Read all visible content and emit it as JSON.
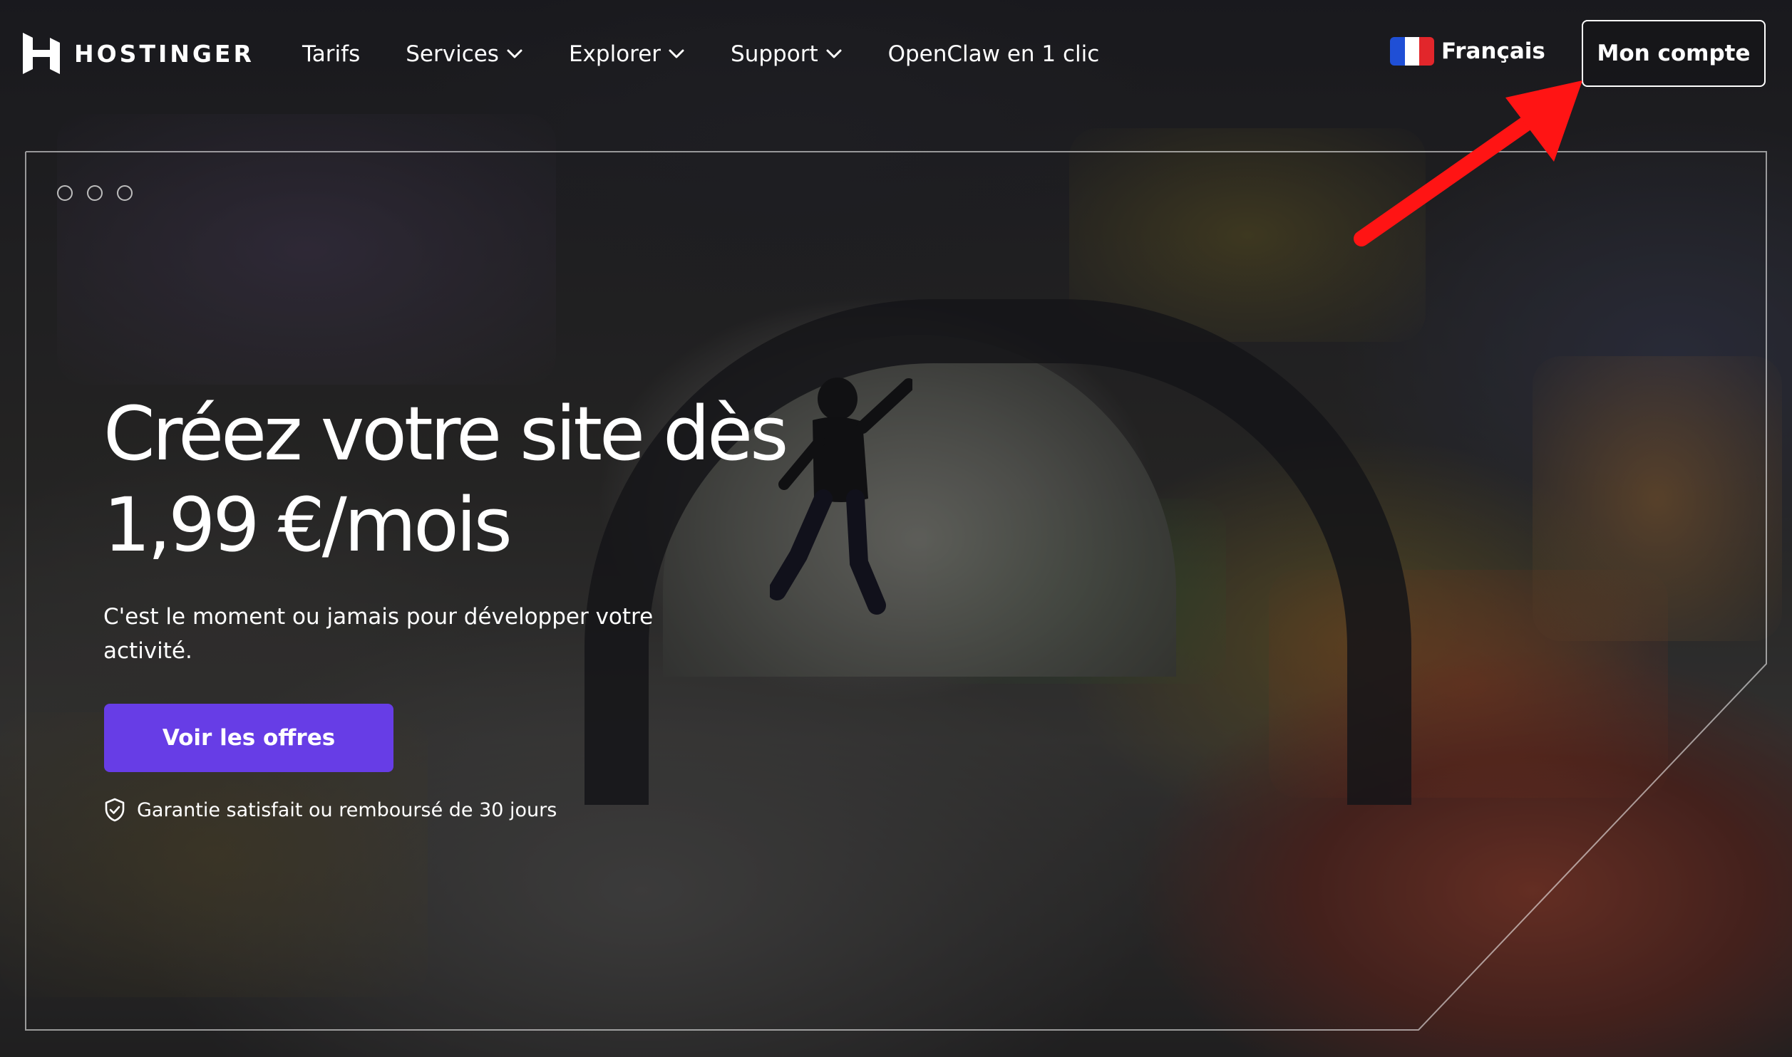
{
  "header": {
    "logo_text": "HOSTINGER",
    "nav": [
      {
        "label": "Tarifs",
        "has_dropdown": false
      },
      {
        "label": "Services",
        "has_dropdown": true
      },
      {
        "label": "Explorer",
        "has_dropdown": true
      },
      {
        "label": "Support",
        "has_dropdown": true
      },
      {
        "label": "OpenClaw en 1 clic",
        "has_dropdown": false
      }
    ],
    "language": {
      "label": "Français",
      "flag": "france-flag-icon"
    },
    "account_button": "Mon compte"
  },
  "hero": {
    "title_line1": "Créez votre site dès",
    "title_line2": "1,99 €/mois",
    "subtitle": "C'est le moment ou jamais pour développer votre activité.",
    "cta_label": "Voir les offres",
    "guarantee": "Garantie satisfait ou remboursé de 30 jours"
  },
  "carousel": {
    "dot_count": 3
  },
  "annotation": {
    "type": "red-arrow",
    "points_to": "account-button"
  },
  "colors": {
    "brand_purple": "#673de6",
    "annotation_red": "#ff1414",
    "text": "#ffffff"
  }
}
